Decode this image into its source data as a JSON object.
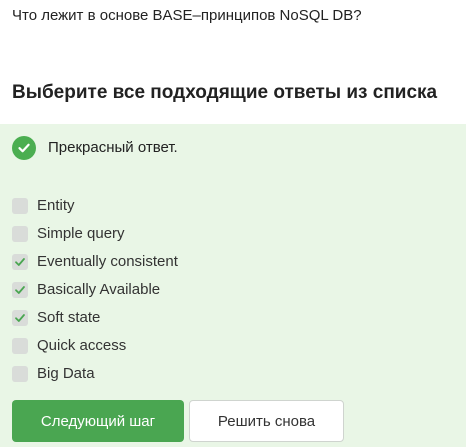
{
  "question": {
    "text": "Что лежит в основе BASE–принципов NoSQL DB?"
  },
  "instruction": {
    "text": "Выберите все подходящие ответы из списка"
  },
  "feedback": {
    "text": "Прекрасный ответ.",
    "icon": "check-circle-icon",
    "color": "#4bae51"
  },
  "options": [
    {
      "label": "Entity",
      "checked": false
    },
    {
      "label": "Simple query",
      "checked": false
    },
    {
      "label": "Eventually consistent",
      "checked": true
    },
    {
      "label": "Basically Available",
      "checked": true
    },
    {
      "label": "Soft state",
      "checked": true
    },
    {
      "label": "Quick access",
      "checked": false
    },
    {
      "label": "Big Data",
      "checked": false
    }
  ],
  "buttons": {
    "next_label": "Следующий шаг",
    "retry_label": "Решить снова"
  },
  "colors": {
    "accent": "#4aa651",
    "panel_background": "#e9f6e6",
    "checkbox_background": "#d9dcd9"
  }
}
